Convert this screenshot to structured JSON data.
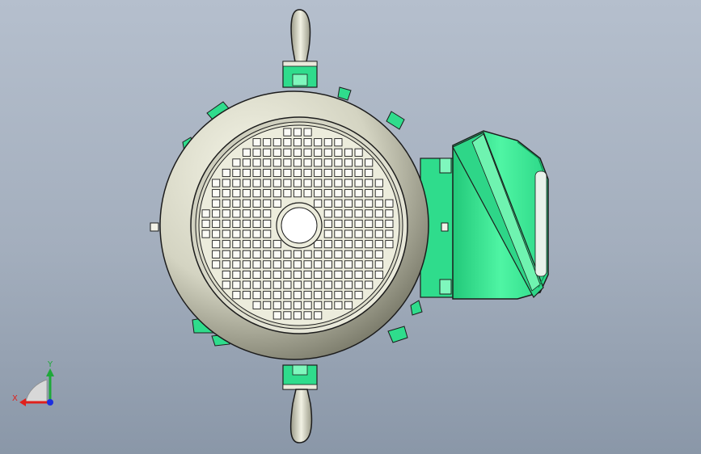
{
  "viewport": {
    "colors": {
      "housing": "#e0e0ce",
      "housing_shadow": "#6e6e5e",
      "grille": "#ececdc",
      "part_green": "#3ef29a",
      "part_green_dark": "#0f8f4f",
      "outline": "#1c1c1c",
      "bg_top": "#b5bfcd",
      "bg_bottom": "#8a97a8"
    },
    "triad": {
      "x_label": "X",
      "y_label": "Y",
      "x_color": "#e0201c",
      "y_color": "#1fa83a",
      "z_color": "#1c2ee0"
    }
  }
}
